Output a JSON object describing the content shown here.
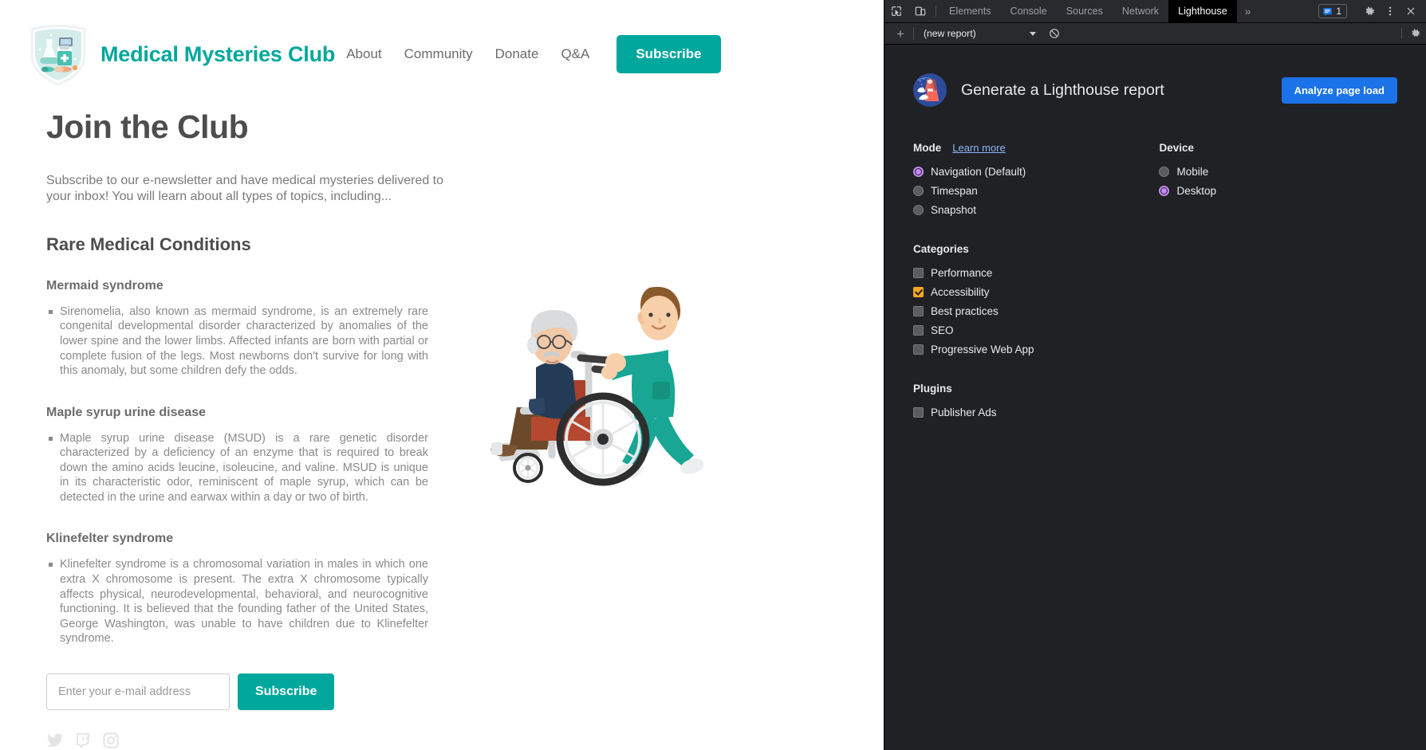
{
  "site": {
    "brand": "Medical Mysteries Club",
    "logo_icon": "medical-shield-logo",
    "nav": [
      {
        "label": "About"
      },
      {
        "label": "Community"
      },
      {
        "label": "Donate"
      },
      {
        "label": "Q&A"
      }
    ],
    "nav_cta": "Subscribe",
    "page_title": "Join the Club",
    "intro": "Subscribe to our e-newsletter and have medical mysteries delivered to your inbox! You will learn about all types of topics, including...",
    "section_heading": "Rare Medical Conditions",
    "topics": [
      {
        "title": "Mermaid syndrome",
        "body": "Sirenomelia, also known as mermaid syndrome, is an extremely rare congenital developmental disorder characterized by anomalies of the lower spine and the lower limbs. Affected infants are born with partial or complete fusion of the legs. Most newborns don't survive for long with this anomaly, but some children defy the odds."
      },
      {
        "title": "Maple syrup urine disease",
        "body": "Maple syrup urine disease (MSUD) is a rare genetic disorder characterized by a deficiency of an enzyme that is required to break down the amino acids leucine, isoleucine, and valine. MSUD is unique in its characteristic odor, reminiscent of maple syrup, which can be detected in the urine and earwax within a day or two of birth."
      },
      {
        "title": "Klinefelter syndrome",
        "body": "Klinefelter syndrome is a chromosomal variation in males in which one extra X chromosome is present. The extra X chromosome typically affects physical, neurodevelopmental, behavioral, and neurocognitive functioning. It is believed that the founding father of the United States, George Washington, was unable to have children due to Klinefelter syndrome."
      }
    ],
    "form": {
      "email_placeholder": "Enter your e-mail address",
      "email_value": "",
      "submit_label": "Subscribe"
    },
    "social": [
      {
        "icon": "twitter-icon"
      },
      {
        "icon": "twitch-icon"
      },
      {
        "icon": "instagram-icon"
      }
    ],
    "illustration_alt": "nurse-pushing-elderly-man-in-wheelchair-illustration",
    "accent_color": "#00a79d"
  },
  "devtools": {
    "toolbar_icons": [
      {
        "icon": "inspect-element-icon"
      },
      {
        "icon": "device-toolbar-icon"
      }
    ],
    "tabs": [
      {
        "label": "Elements",
        "active": false
      },
      {
        "label": "Console",
        "active": false
      },
      {
        "label": "Sources",
        "active": false
      },
      {
        "label": "Network",
        "active": false
      },
      {
        "label": "Lighthouse",
        "active": true
      }
    ],
    "more_tabs_label": "»",
    "issues_count": "1",
    "issues_icon": "issues-icon",
    "settings_icon": "gear-icon",
    "more_options_icon": "kebab-menu-icon",
    "close_icon": "close-icon",
    "subbar": {
      "add_label": "+",
      "report_select_value": "(new report)",
      "clear_icon": "clear-icon",
      "settings_icon": "gear-icon"
    },
    "lighthouse": {
      "logo_icon": "lighthouse-logo",
      "title": "Generate a Lighthouse report",
      "analyze_button": "Analyze page load",
      "mode": {
        "title": "Mode",
        "learn_more": "Learn more",
        "options": [
          {
            "label": "Navigation (Default)",
            "checked": true
          },
          {
            "label": "Timespan",
            "checked": false
          },
          {
            "label": "Snapshot",
            "checked": false
          }
        ]
      },
      "device": {
        "title": "Device",
        "options": [
          {
            "label": "Mobile",
            "checked": false
          },
          {
            "label": "Desktop",
            "checked": true
          }
        ]
      },
      "categories": {
        "title": "Categories",
        "options": [
          {
            "label": "Performance",
            "checked": false
          },
          {
            "label": "Accessibility",
            "checked": true
          },
          {
            "label": "Best practices",
            "checked": false
          },
          {
            "label": "SEO",
            "checked": false
          },
          {
            "label": "Progressive Web App",
            "checked": false
          }
        ]
      },
      "plugins": {
        "title": "Plugins",
        "options": [
          {
            "label": "Publisher Ads",
            "checked": false
          }
        ]
      },
      "accent_blue": "#1a73e8",
      "radio_accent": "#c58af9",
      "checkbox_accent": "#f5a623"
    }
  }
}
